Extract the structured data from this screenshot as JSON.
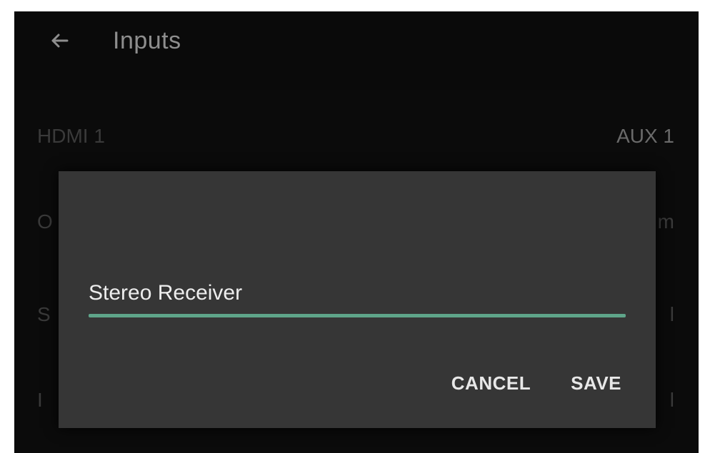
{
  "appbar": {
    "back_icon": "arrow-left-icon",
    "title": "Inputs"
  },
  "list": {
    "rows": [
      {
        "left": "HDMI 1",
        "right": "AUX 1"
      },
      {
        "left": "O",
        "right": "m"
      },
      {
        "left": "S",
        "right": "l"
      },
      {
        "left": "I",
        "right": "l"
      }
    ]
  },
  "dialog": {
    "input_value": "Stereo Receiver",
    "cancel_label": "CANCEL",
    "save_label": "SAVE"
  },
  "colors": {
    "screen_bg": "#060606",
    "dialog_bg": "#363636",
    "accent": "#5fa58a",
    "text_primary": "#ededed",
    "text_dim": "#8e8e8e"
  }
}
